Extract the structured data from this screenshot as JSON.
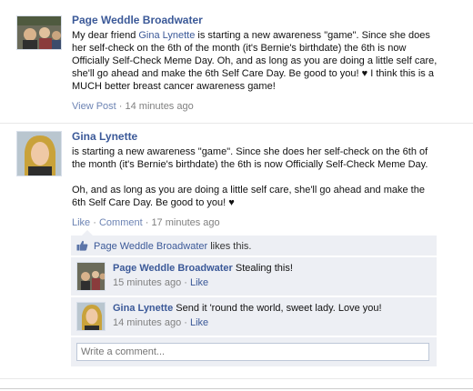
{
  "colors": {
    "link": "#3b5998",
    "meta": "#808080",
    "ufi_bg": "#edeff4"
  },
  "post1": {
    "author": "Page Weddle Broadwater",
    "message_prefix": "My dear friend ",
    "mention": "Gina Lynette",
    "message_lines": [
      "is starting a new awareness \"game\". Since she does",
      "her self-check on the 6th of the month (it's Bernie's birthdate) the 6th is now",
      "Officially Self-Check Meme Day. Oh, and as long as you are doing a little self care,",
      "she'll go ahead and make the 6th Self Care Day. Be good to you! ♥ I think this is a",
      "MUCH better breast cancer awareness game!"
    ],
    "view_post": "View Post",
    "separator": " · ",
    "time": "14 minutes ago"
  },
  "post2": {
    "author": "Gina Lynette",
    "paragraph1": [
      "is starting a new awareness \"game\". Since she does her self-check on the 6th of",
      "the month (it's Bernie's birthdate) the 6th is now Officially Self-Check Meme Day."
    ],
    "paragraph2": [
      "Oh, and as long as you are doing a little self care, she'll go ahead and make the",
      "6th Self Care Day. Be good to you! ♥"
    ],
    "like": "Like",
    "separator": " · ",
    "comment": "Comment",
    "time": "17 minutes ago",
    "likes": {
      "name": "Page Weddle Broadwater",
      "text": " likes this."
    },
    "comments": [
      {
        "author": "Page Weddle Broadwater",
        "text": " Stealing this!",
        "time": "15 minutes ago",
        "separator": " · ",
        "like": "Like"
      },
      {
        "author": "Gina Lynette",
        "text": " Send it 'round the world, sweet lady. Love you!",
        "time": "14 minutes ago",
        "separator": " · ",
        "like": "Like"
      }
    ],
    "comment_placeholder": "Write a comment..."
  }
}
